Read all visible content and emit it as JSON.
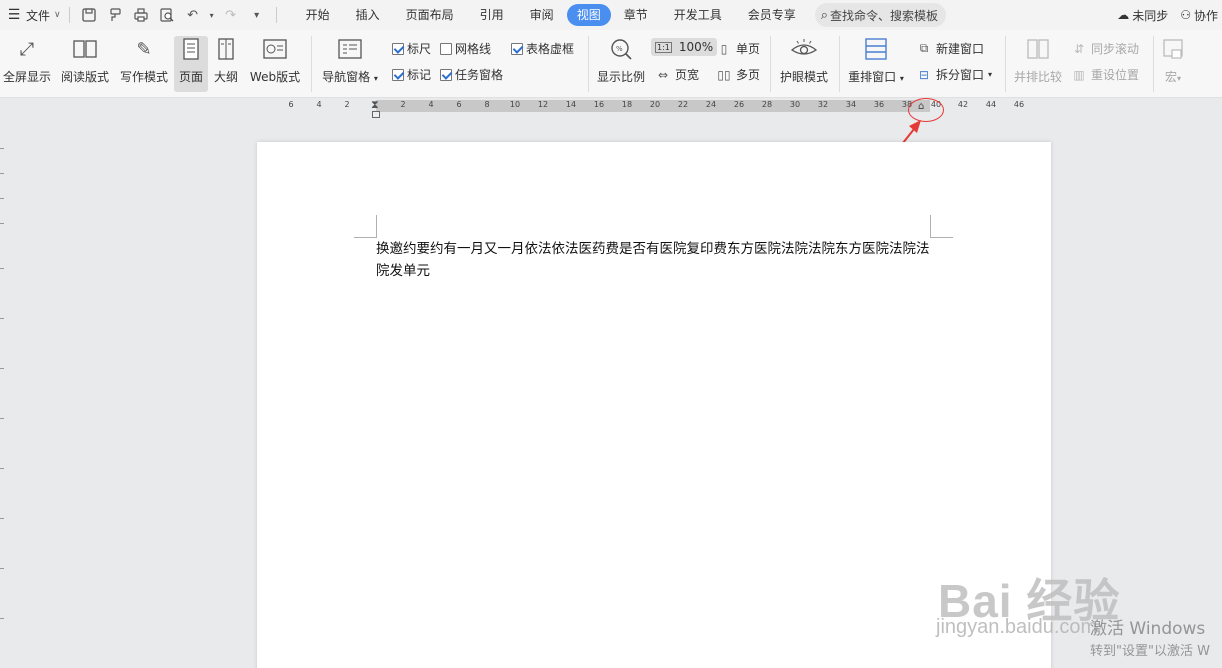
{
  "menubar": {
    "file_label": "文件",
    "tabs": [
      {
        "label": "开始"
      },
      {
        "label": "插入"
      },
      {
        "label": "页面布局"
      },
      {
        "label": "引用"
      },
      {
        "label": "审阅"
      },
      {
        "label": "视图",
        "active": true
      },
      {
        "label": "章节"
      },
      {
        "label": "开发工具"
      },
      {
        "label": "会员专享"
      }
    ],
    "search_label": "查找命令、搜索模板",
    "sync_label": "未同步",
    "collab_label": "协作"
  },
  "ribbon": {
    "fullscreen": "全屏显示",
    "reading": "阅读版式",
    "writing": "写作模式",
    "page": "页面",
    "outline": "大纲",
    "web": "Web版式",
    "nav_pane": "导航窗格",
    "ruler": "标尺",
    "gridlines": "网格线",
    "table_borders": "表格虚框",
    "marks": "标记",
    "task_pane": "任务窗格",
    "zoom": "显示比例",
    "zoom_100": "100%",
    "page_width": "页宽",
    "single_page": "单页",
    "multi_page": "多页",
    "eye_mode": "护眼模式",
    "arrange": "重排窗口",
    "new_window": "新建窗口",
    "split_window": "拆分窗口",
    "side_by_side": "并排比较",
    "sync_scroll": "同步滚动",
    "reset_position": "重设位置",
    "macro": "宏"
  },
  "checkboxes": {
    "ruler": true,
    "gridlines": false,
    "table_borders": true,
    "marks": true,
    "task_pane": true
  },
  "ruler": {
    "left_ticks": [
      "6",
      "4",
      "2"
    ],
    "right_ticks": [
      "2",
      "4",
      "6",
      "8",
      "10",
      "12",
      "14",
      "16",
      "18",
      "20",
      "22",
      "24",
      "26",
      "28",
      "30",
      "32",
      "34",
      "36",
      "38",
      "40",
      "42",
      "44",
      "46"
    ]
  },
  "document": {
    "text": "换邀约要约有一月又一月依法依法医药费是否有医院复印费东方医院法院法院东方医院法院法院发单元"
  },
  "watermark": {
    "logo": "Bai   经验",
    "site": "jingyan.baidu.com",
    "activation_line1": "激活 Windows",
    "activation_line2": "转到\"设置\"以激活 W"
  }
}
